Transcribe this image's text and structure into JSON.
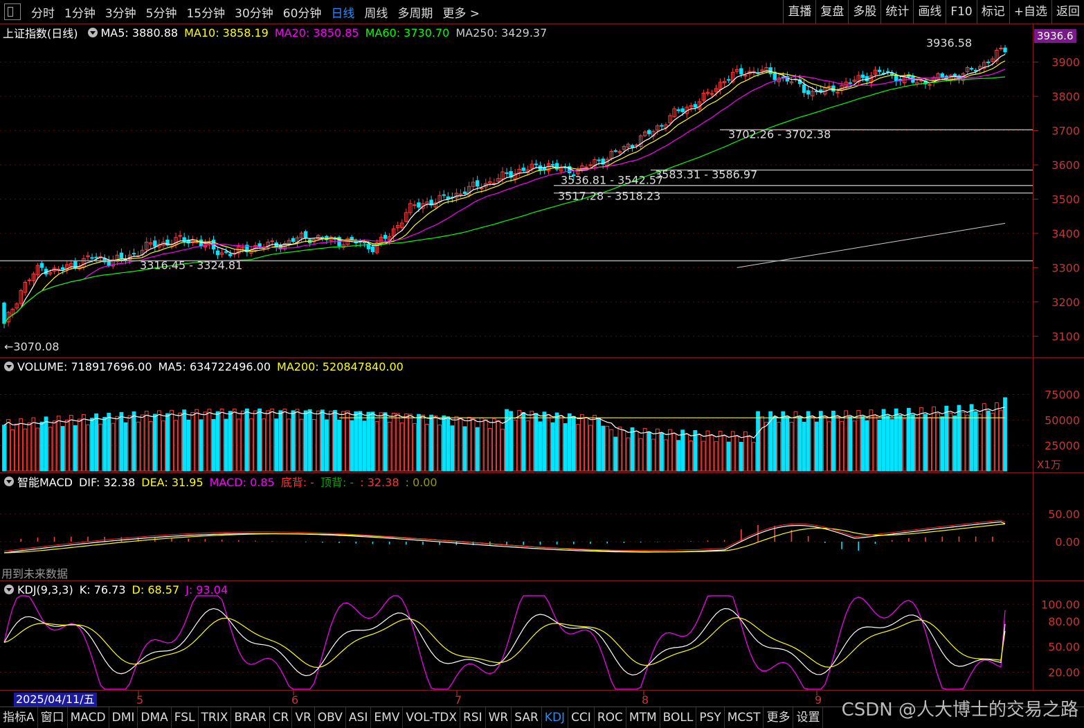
{
  "top_tabs": [
    {
      "label": "分时",
      "active": false
    },
    {
      "label": "1分钟",
      "active": false
    },
    {
      "label": "3分钟",
      "active": false
    },
    {
      "label": "5分钟",
      "active": false
    },
    {
      "label": "15分钟",
      "active": false
    },
    {
      "label": "30分钟",
      "active": false
    },
    {
      "label": "60分钟",
      "active": false
    },
    {
      "label": "日线",
      "active": true
    },
    {
      "label": "周线",
      "active": false
    },
    {
      "label": "多周期",
      "active": false
    },
    {
      "label": "更多 >",
      "active": false
    }
  ],
  "right_buttons": [
    "直播",
    "复盘",
    "多股",
    "统计",
    "画线",
    "F10",
    "标记",
    "+自选",
    "返回"
  ],
  "main_panel": {
    "title": "上证指数(日线)",
    "ma": [
      {
        "label": "MA5: 3880.88",
        "color": "#ffffff"
      },
      {
        "label": "MA10: 3858.19",
        "color": "#ffff00"
      },
      {
        "label": "MA20: 3850.85",
        "color": "#ff00ff"
      },
      {
        "label": "MA60: 3730.70",
        "color": "#00ff00"
      },
      {
        "label": "MA250: 3429.37",
        "color": "#cccccc"
      }
    ],
    "price_badge": "3936.6"
  },
  "volume_panel": {
    "labels": [
      {
        "label": "VOLUME: 718917696.00",
        "color": "#ffffff"
      },
      {
        "label": "MA5: 634722496.00",
        "color": "#ffffff"
      },
      {
        "label": "MA200: 520847840.00",
        "color": "#ffff00"
      }
    ],
    "unit": "X1万"
  },
  "macd_panel": {
    "labels": [
      {
        "label": "智能MACD",
        "color": "#ffffff"
      },
      {
        "label": "DIF: 32.38",
        "color": "#ffffff"
      },
      {
        "label": "DEA: 31.95",
        "color": "#ffff00"
      },
      {
        "label": "MACD: 0.85",
        "color": "#ff00ff"
      },
      {
        "label": "底背: -",
        "color": "#ff3333"
      },
      {
        "label": "顶背: -",
        "color": "#00aa00"
      },
      {
        "label": ": 32.38",
        "color": "#ff3333"
      },
      {
        "label": ": 0.00",
        "color": "#999900"
      }
    ],
    "note": "用到未来数据"
  },
  "kdj_panel": {
    "labels": [
      {
        "label": "KDJ(9,3,3)",
        "color": "#ffffff"
      },
      {
        "label": "K: 76.73",
        "color": "#ffffff"
      },
      {
        "label": "D: 68.57",
        "color": "#ffff00"
      },
      {
        "label": "J: 93.04",
        "color": "#ff00ff"
      }
    ]
  },
  "bottom_tabs": [
    "指标A",
    "窗口",
    "MACD",
    "DMI",
    "DMA",
    "FSL",
    "TRIX",
    "BRAR",
    "CR",
    "VR",
    "OBV",
    "ASI",
    "EMV",
    "VOL-TDX",
    "RSI",
    "WR",
    "SAR",
    "KDJ",
    "CCI",
    "ROC",
    "MTM",
    "BOLL",
    "PSY",
    "MCST",
    "更多",
    "设置"
  ],
  "bottom_active": "KDJ",
  "watermark": "CSDN @人大博士的交易之路",
  "chart_data": [
    {
      "type": "candlestick",
      "title": "上证指数(日线)",
      "ylim": [
        3050,
        3960
      ],
      "yticks": [
        3100,
        3200,
        3300,
        3400,
        3500,
        3600,
        3700,
        3800,
        3900
      ],
      "date_label": "2025/04/11/五",
      "month_ticks": [
        "5",
        "6",
        "7",
        "8",
        "9"
      ],
      "series_anchors": {
        "close": [
          3130,
          3240,
          3300,
          3290,
          3310,
          3330,
          3320,
          3328,
          3360,
          3372,
          3380,
          3378,
          3350,
          3340,
          3360,
          3365,
          3370,
          3390,
          3385,
          3378,
          3375,
          3360,
          3395,
          3470,
          3490,
          3500,
          3520,
          3540,
          3555,
          3580,
          3590,
          3600,
          3580,
          3590,
          3615,
          3640,
          3670,
          3700,
          3745,
          3770,
          3800,
          3850,
          3870,
          3875,
          3860,
          3840,
          3810,
          3820,
          3835,
          3860,
          3870,
          3855,
          3840,
          3850,
          3860,
          3870,
          3905,
          3937
        ]
      },
      "annotations": [
        {
          "text": "3936.58",
          "value": 3936.58
        },
        {
          "text": "3702.26 - 3702.38",
          "value": 3702.3
        },
        {
          "text": "3583.31 - 3586.97",
          "value": 3585
        },
        {
          "text": "3536.81 - 3542.57",
          "value": 3540
        },
        {
          "text": "3517.28 - 3518.23",
          "value": 3518
        },
        {
          "text": "3316.45 - 3324.81",
          "value": 3320
        },
        {
          "text": "3070.08",
          "value": 3070.08
        }
      ],
      "ma_values": {
        "MA5": 3880.88,
        "MA10": 3858.19,
        "MA20": 3850.85,
        "MA60": 3730.7,
        "MA250": 3429.37
      }
    },
    {
      "type": "bar",
      "title": "VOLUME",
      "ylim": [
        0,
        95000
      ],
      "yticks": [
        25000,
        50000,
        75000
      ],
      "unit": "X1万",
      "last_value": 71891.77,
      "ma5": 63472.25,
      "ma200": 52084.78
    },
    {
      "type": "bar",
      "title": "智能MACD",
      "yticks": [
        0,
        50
      ],
      "DIF": 32.38,
      "DEA": 31.95,
      "MACD": 0.85
    },
    {
      "type": "line",
      "title": "KDJ(9,3,3)",
      "ylim": [
        0,
        110
      ],
      "yticks": [
        20,
        50,
        80,
        100
      ],
      "K": 76.73,
      "D": 68.57,
      "J": 93.04
    }
  ]
}
